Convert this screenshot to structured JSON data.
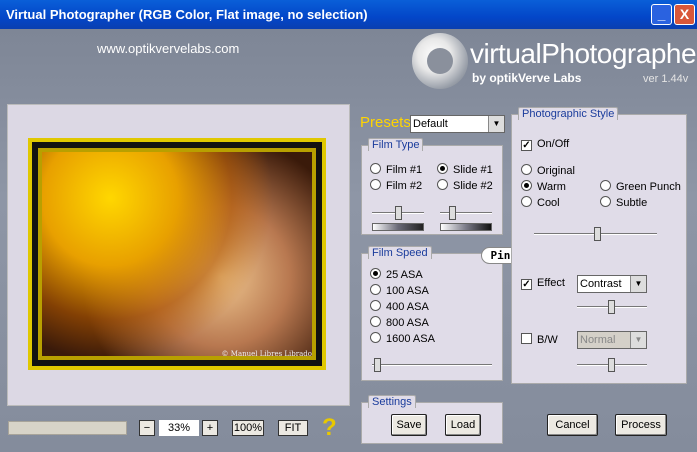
{
  "window": {
    "title": "Virtual Photographer (RGB Color, Flat image, no selection)",
    "minimize_label": "_",
    "close_label": "X"
  },
  "header": {
    "url": "www.optikvervelabs.com",
    "logo_text": "virtualPhotographer",
    "logo_sub": "by optikVerve Labs",
    "version": "ver 1.44v"
  },
  "preview": {
    "credit": "© Manuel Libres Librado"
  },
  "zoom": {
    "minus_label": "−",
    "value": "33%",
    "plus_label": "+",
    "hundred_label": "100%",
    "fit_label": "FIT",
    "help_label": "?"
  },
  "presets": {
    "label": "Presets",
    "selected": "Default"
  },
  "film_type": {
    "title": "Film Type",
    "options": [
      {
        "label": "Film #1",
        "selected": false
      },
      {
        "label": "Slide #1",
        "selected": true
      },
      {
        "label": "Film #2",
        "selected": false
      },
      {
        "label": "Slide #2",
        "selected": false
      }
    ]
  },
  "film_speed": {
    "title": "Film Speed",
    "options": [
      {
        "label": "25 ASA",
        "selected": true
      },
      {
        "label": "100 ASA",
        "selected": false
      },
      {
        "label": "400 ASA",
        "selected": false
      },
      {
        "label": "800 ASA",
        "selected": false
      },
      {
        "label": "1600 ASA",
        "selected": false
      }
    ]
  },
  "photographic_style": {
    "title": "Photographic Style",
    "on_off_label": "On/Off",
    "on_off_checked": true,
    "options": [
      {
        "label": "Original",
        "selected": false
      },
      {
        "label": "Warm",
        "selected": true
      },
      {
        "label": "Green Punch",
        "selected": false
      },
      {
        "label": "Cool",
        "selected": false
      },
      {
        "label": "Subtle",
        "selected": false
      }
    ],
    "effect_label": "Effect",
    "effect_checked": true,
    "effect_value": "Contrast",
    "bw_label": "B/W",
    "bw_checked": false,
    "bw_value": "Normal"
  },
  "settings": {
    "title": "Settings",
    "save_label": "Save",
    "load_label": "Load"
  },
  "actions": {
    "cancel_label": "Cancel",
    "process_label": "Process"
  },
  "watermark": "Pinuccia",
  "colors": {
    "title_bar": "#0346c8",
    "presets_label": "#ffd400",
    "panel_title": "#1a3c9c",
    "panel_bg": "#e0dce8",
    "window_bg": "#848c9c"
  }
}
